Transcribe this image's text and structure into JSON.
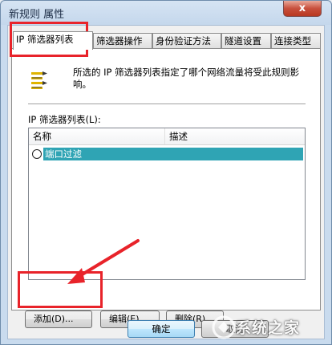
{
  "window": {
    "title": "新规则 属性",
    "close_label": "x"
  },
  "tabs": [
    {
      "label": "IP 筛选器列表",
      "active": true
    },
    {
      "label": "筛选器操作"
    },
    {
      "label": "身份验证方法"
    },
    {
      "label": "隧道设置"
    },
    {
      "label": "连接类型"
    }
  ],
  "page": {
    "description": "所选的 IP 筛选器列表指定了哪个网络流量将受此规则影响。",
    "list_label": "IP 筛选器列表(L):",
    "columns": [
      "名称",
      "描述"
    ],
    "rows": [
      {
        "name": "端口过滤",
        "selected": true
      }
    ],
    "buttons": {
      "add": "添加(D)...",
      "edit": "编辑(E)...",
      "delete": "删除(R)"
    }
  },
  "footer": {
    "ok": "确定",
    "cancel": "取消"
  },
  "watermark": {
    "text": "系统之家"
  },
  "colors": {
    "selection": "#2fa4b4",
    "annotation": "#e8232a"
  },
  "icons": [
    "filter-list-icon",
    "radio-icon",
    "watermark-logo-icon"
  ]
}
